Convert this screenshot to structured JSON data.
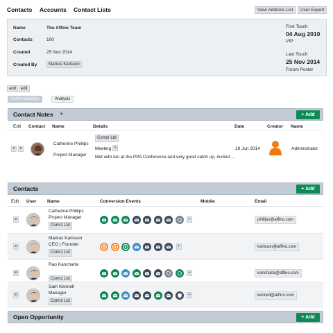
{
  "nav": {
    "tabs": [
      "Contacts",
      "Accounts",
      "Contact Lists"
    ],
    "buttons": [
      "View Address List",
      "User Export"
    ]
  },
  "summary": {
    "name_label": "Name",
    "name": "The Affino Team",
    "contacts_label": "Contacts",
    "contacts": "100",
    "created_label": "Created",
    "created": "25 Nov 2014",
    "created_by_label": "Created By",
    "created_by": "Markus Karlsson",
    "first_touch_label": "First Touch",
    "first_touch_date": "04 Aug 2010",
    "first_touch_type": "VIP",
    "last_touch_label": "Last Touch",
    "last_touch_date": "25 Nov 2014",
    "last_touch_type": "Forum Poster"
  },
  "actions": {
    "add": "add",
    "edit": "edit"
  },
  "subtabs": [
    "Communication",
    "Analysis"
  ],
  "notes": {
    "title": "Contact Notes",
    "plus": "+",
    "add_label": "+ Add",
    "columns": [
      "Edit",
      "Contact",
      "Name",
      "Details",
      "Date",
      "Creator",
      "Name"
    ],
    "row": {
      "v": "v",
      "e": "e",
      "name": "Catherine Phillips",
      "role": "Project Manager",
      "account": "Comrz Ltd",
      "type": "Meeting",
      "type_plus": "+",
      "detail": "Met with Ian at the PPA Conference and very good catch up, invited ...",
      "date": "19 Jun 2014",
      "creator_name": "Administrator"
    }
  },
  "contacts": {
    "title": "Contacts",
    "add_label": "+ Add",
    "columns": [
      "Edit",
      "User",
      "Name",
      "Conversion Events",
      "Mobile",
      "Email"
    ],
    "rows": [
      {
        "e": "e",
        "name": "Catherine Phillips",
        "role": "Project Manager",
        "account": "Comrz Ltd",
        "email": "phillips@affino.com",
        "events": [
          "green-mail",
          "green-mail",
          "green-mail",
          "navy-mail",
          "navy-mail",
          "navy-mail",
          "navy-mail",
          "gray-gear"
        ],
        "plus": "+"
      },
      {
        "e": "e",
        "name": "Markus Karlsson",
        "role": "CEO | Founder",
        "account": "Comrz Ltd",
        "email": "karlsson@affino.com",
        "events": [
          "orange-target",
          "orange-target",
          "green-target",
          "blue-mail",
          "navy-mail",
          "navy-mail",
          "navy-mail"
        ],
        "plus": "+"
      },
      {
        "e": "e",
        "name": "Rao Kancharla",
        "role": "",
        "account": "Comrz Ltd",
        "email": "kancharla@affino.com",
        "events": [
          "green-mail",
          "green-mail",
          "blue-mail",
          "green-mail",
          "navy-mail",
          "navy-mail",
          "gray-gear",
          "green-gear"
        ],
        "plus": "+"
      },
      {
        "e": "e",
        "name": "Sam Kennell",
        "role": "Manager",
        "account": "Comrz Ltd",
        "email": "kennell@affino.com",
        "events": [
          "green-mail",
          "green-mail",
          "blue-mail",
          "navy-mail",
          "navy-mail",
          "green-mail",
          "navy-mail",
          "navy-badge"
        ],
        "plus": "+"
      }
    ]
  },
  "opportunity": {
    "title": "Open Opportunity",
    "add_label": "+ Add"
  },
  "colors": {
    "green": "#0e8a58",
    "navy": "#3c4a5c",
    "orange": "#f08a24",
    "header": "#c3ccd5"
  }
}
